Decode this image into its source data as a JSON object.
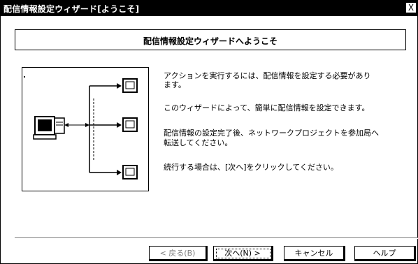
{
  "window": {
    "title": "配信情報設定ウィザード[ようこそ]",
    "close_symbol": "X"
  },
  "header": {
    "title": "配信情報設定ウィザードへようこそ"
  },
  "body": {
    "line1": "アクションを実行するには、配信情報を設定する必要があり",
    "line2": "ます。",
    "line3": "このウィザードによって、簡単に配信情報を設定できます。",
    "line4": "配信情報の設定完了後、ネットワークプロジェクトを参加局へ",
    "line5": "転送してください。",
    "line6": "続行する場合は、[次へ]をクリックしてください。"
  },
  "buttons": {
    "back": "< 戻る(B)",
    "next": "次へ(N) >",
    "cancel": "キャンセル",
    "help": "ヘルプ"
  },
  "icons": {
    "close": "close-icon",
    "computer": "computer-icon",
    "terminal": "terminal-icon"
  }
}
